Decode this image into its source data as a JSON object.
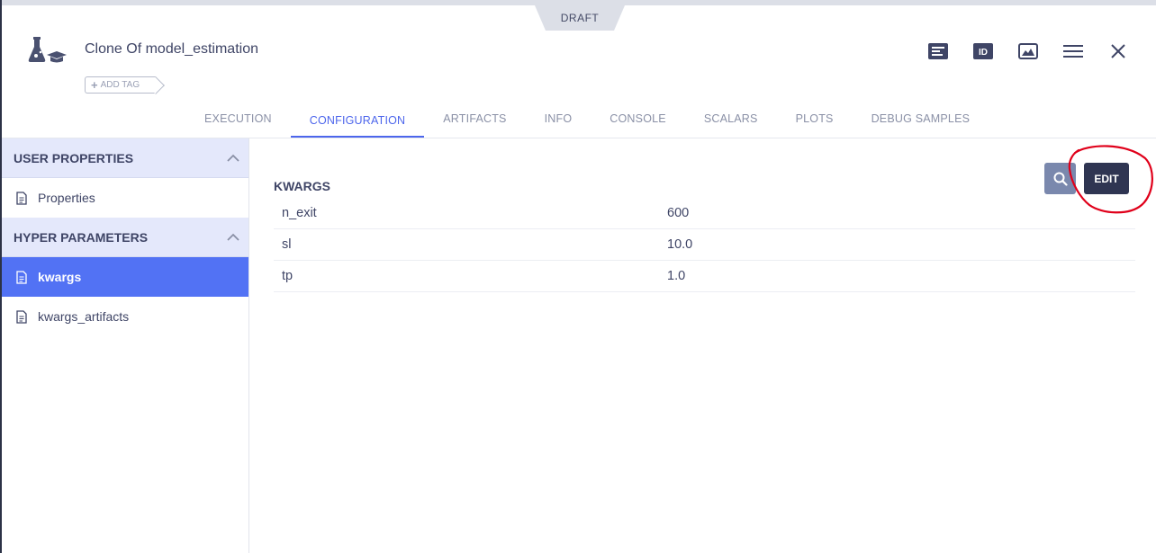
{
  "badge": "DRAFT",
  "header": {
    "title": "Clone Of model_estimation",
    "add_tag": "ADD TAG",
    "actions": [
      "info-panel-icon",
      "id-icon",
      "results-icon",
      "menu-icon",
      "close-icon"
    ]
  },
  "tabs": [
    {
      "label": "EXECUTION",
      "active": false
    },
    {
      "label": "CONFIGURATION",
      "active": true
    },
    {
      "label": "ARTIFACTS",
      "active": false
    },
    {
      "label": "INFO",
      "active": false
    },
    {
      "label": "CONSOLE",
      "active": false
    },
    {
      "label": "SCALARS",
      "active": false
    },
    {
      "label": "PLOTS",
      "active": false
    },
    {
      "label": "DEBUG SAMPLES",
      "active": false
    }
  ],
  "sidebar": {
    "sections": [
      {
        "title": "USER PROPERTIES",
        "items": [
          {
            "label": "Properties",
            "active": false
          }
        ]
      },
      {
        "title": "HYPER PARAMETERS",
        "items": [
          {
            "label": "kwargs",
            "active": true
          },
          {
            "label": "kwargs_artifacts",
            "active": false
          }
        ]
      }
    ]
  },
  "main": {
    "section_title": "KWARGS",
    "edit_label": "EDIT",
    "params": [
      {
        "name": "n_exit",
        "value": "600"
      },
      {
        "name": "sl",
        "value": "10.0"
      },
      {
        "name": "tp",
        "value": "1.0"
      }
    ]
  },
  "colors": {
    "accent": "#4d66ec",
    "selected_row": "#5272f4",
    "edit_button": "#2f3552",
    "section_header": "#e4e8fb",
    "annotation": "#e0001a"
  }
}
